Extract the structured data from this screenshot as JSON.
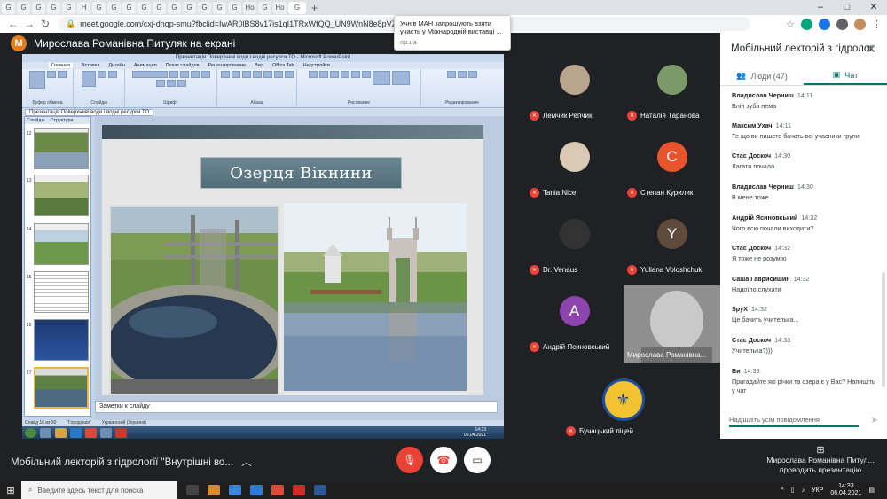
{
  "browser": {
    "url": "meet.google.com/cxj-dnqp-smu?fbclid=IwAR0lBS8v17is1qI1TRxWfQQ_UN9WnN8e8pVZJ2yTxiLhsx4OCmn1x7WMY",
    "notification_title": "Учнів МАН запрошують взяти участь у Міжнародній виставці ...",
    "notification_source": "op.ua",
    "tab_letters": [
      "G",
      "G",
      "G",
      "G",
      "G",
      "H",
      "G",
      "G",
      "G",
      "G",
      "G",
      "G",
      "G",
      "G",
      "G",
      "G",
      "Ho",
      "G",
      "Ho",
      "G"
    ],
    "new_tab": "+"
  },
  "meet": {
    "presenter_initial": "M",
    "presenter_banner": "Мирослава Романівна Питуляк на екрані",
    "meeting_name": "Мобільний лекторій з гідрології \"Внутрішні во...",
    "presenting_name": "Мирослава Романівна Питул...",
    "presenting_label": "проводить презентацію"
  },
  "ppt": {
    "window_title": "Презентація Поверхневі води і водні ресурси ТО - Microsoft PowerPoint",
    "tabs": [
      "Главная",
      "Вставка",
      "Дизайн",
      "Анимация",
      "Показ слайдов",
      "Рецензирование",
      "Вид",
      "Office Tab",
      "Надстройки"
    ],
    "groups": [
      "Буфер обмена",
      "Слайды",
      "Шрифт",
      "Абзац",
      "Рисование",
      "Редактирование"
    ],
    "doc_tab": "Презентація Поверхневі води і водні ресурси ТО",
    "panel_tabs": [
      "Слайды",
      "Структура"
    ],
    "slide_title": "Озерця Вікнини",
    "notes": "Заметки к слайду",
    "status": [
      "Слайд 16 из 50",
      "\"Городская\"",
      "Украинский (Украина)"
    ],
    "slide_numbers": [
      "12",
      "13",
      "14",
      "15",
      "16",
      "17"
    ],
    "clock_time": "14:33",
    "clock_date": "06.04.2021"
  },
  "participants": [
    {
      "name": "Лемчик Репчик",
      "color": "#b9a48c"
    },
    {
      "name": "Наталія Таранова",
      "color": "#7a9a6a"
    },
    {
      "name": "Tania Nice",
      "color": "#d9c9b5"
    },
    {
      "name": "Степан Курилик",
      "initial": "C",
      "color": "#e8542c"
    },
    {
      "name": "Dr. Venaus",
      "color": "#333333"
    },
    {
      "name": "Yuliana Voloshchuk",
      "initial": "Y",
      "color": "#5f4a3b"
    },
    {
      "name": "Андрій Ясиновський",
      "initial": "A",
      "color": "#8e44ad"
    },
    {
      "name": "Мирослава Романівна..."
    },
    {
      "name": "Бучацький ліцей"
    }
  ],
  "chat": {
    "title": "Мобільний лекторій з гідрології...",
    "people_tab": "Люди (47)",
    "chat_tab": "Чат",
    "input_placeholder": "Надішліть усім повідомлення",
    "messages": [
      {
        "author": "Владислав Черниш",
        "time": "14:11",
        "text": "Блін зуба нема"
      },
      {
        "author": "Максим Ухач",
        "time": "14:11",
        "text": "Те що ви пишете бачать всі учасники групи"
      },
      {
        "author": "Стас Доскоч",
        "time": "14:30",
        "text": "Лагати почало"
      },
      {
        "author": "Владислав Черниш",
        "time": "14:30",
        "text": "В мене тоже"
      },
      {
        "author": "Андрій Ясиновський",
        "time": "14:32",
        "text": "Чого всю почали виходити?"
      },
      {
        "author": "Стас Доскоч",
        "time": "14:32",
        "text": "Я тоже не розумію"
      },
      {
        "author": "Саша Гавриcишин",
        "time": "14:32",
        "text": "Надоїло слухати"
      },
      {
        "author": "SpyX",
        "time": "14:32",
        "text": "Це бачить учителька..."
      },
      {
        "author": "Стас Доскоч",
        "time": "14:33",
        "text": "Учителька?)))"
      },
      {
        "author": "Ви",
        "time": "14:33",
        "text": "Пригадайте які річки та озера є у Вас? Напишіть у чат"
      }
    ]
  },
  "taskbar": {
    "search_placeholder": "Введите здесь текст для поиска",
    "lang": "УКР",
    "time": "14:33",
    "date": "06.04.2021"
  }
}
